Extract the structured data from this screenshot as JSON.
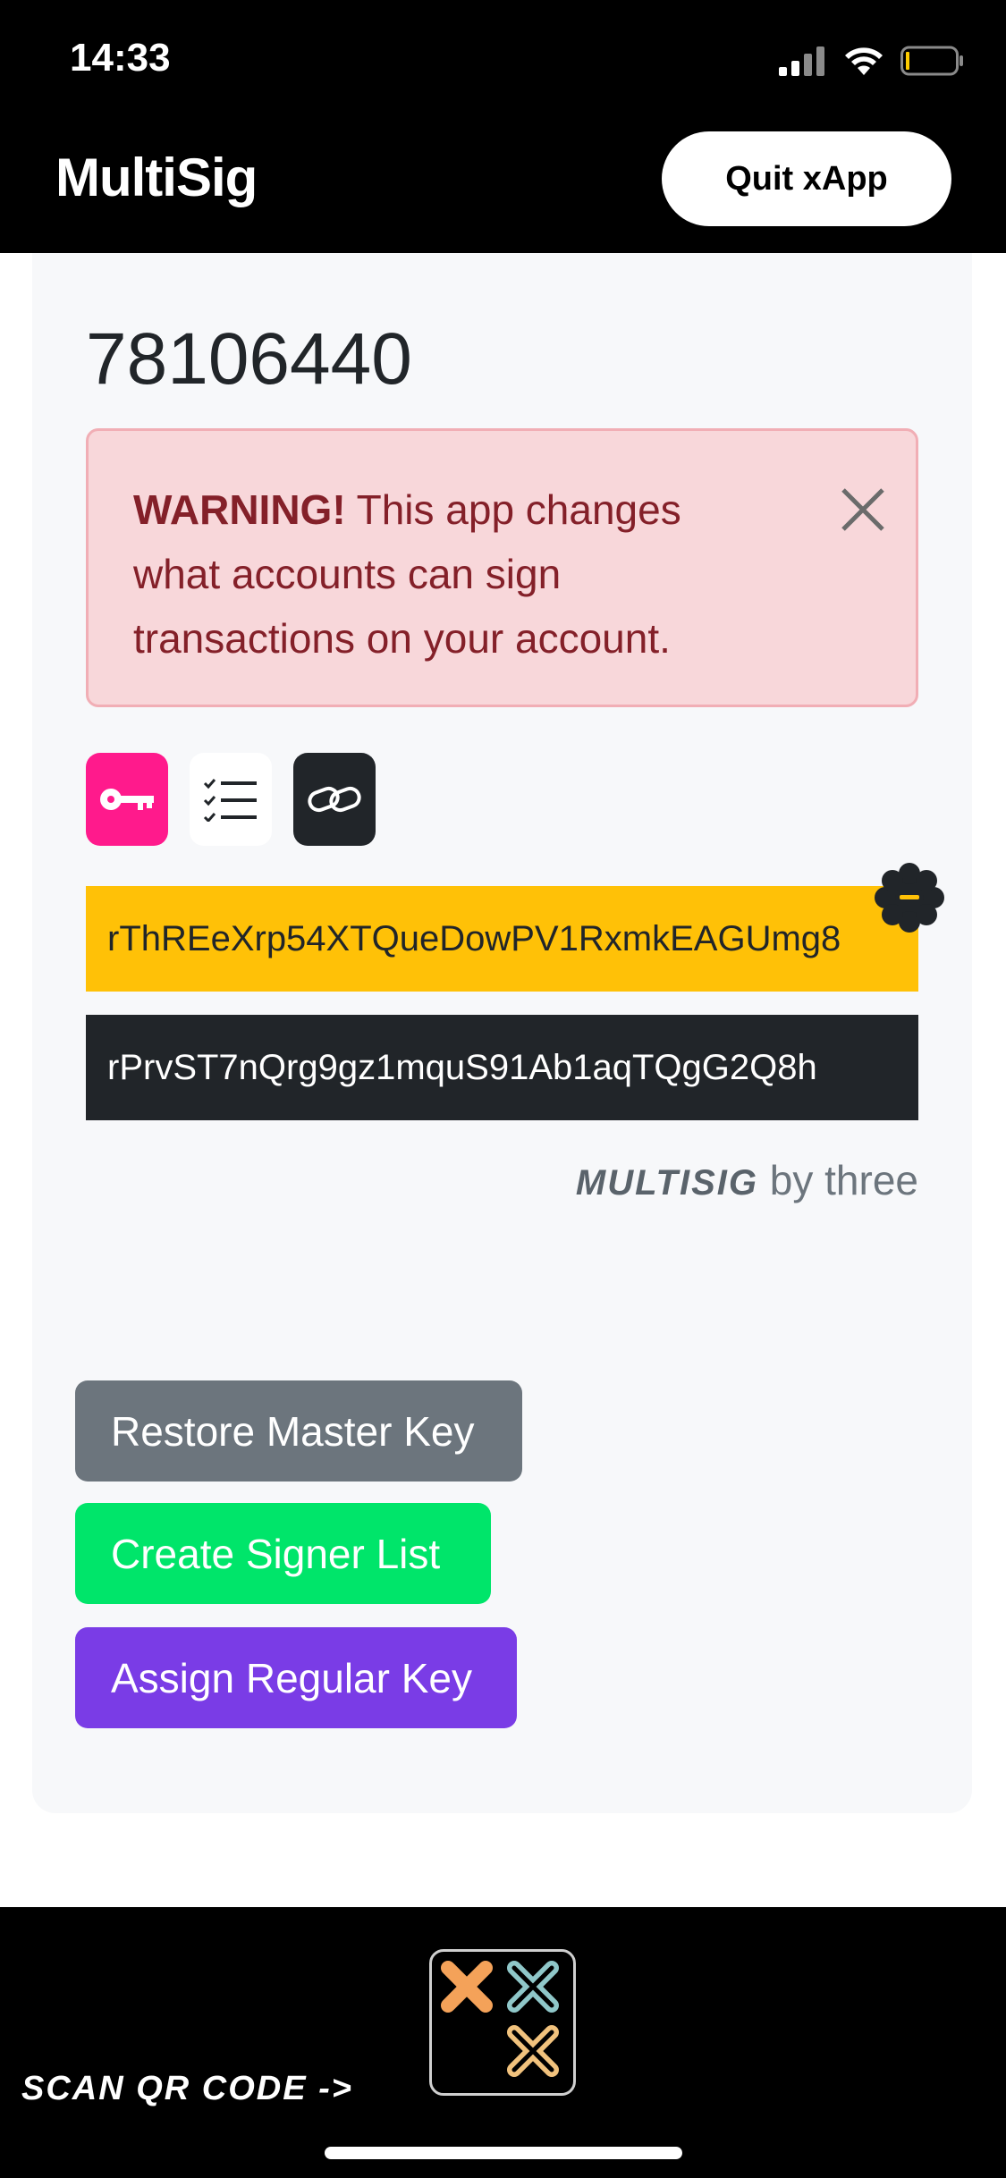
{
  "status_bar": {
    "time": "14:33",
    "icons": [
      "signal-icon",
      "wifi-icon",
      "battery-icon"
    ]
  },
  "header": {
    "title": "MultiSig",
    "quit_label": "Quit xApp"
  },
  "account": {
    "id": "78106440"
  },
  "warning": {
    "bold": "WARNING!",
    "text": " This app changes what accounts can sign transactions on your account."
  },
  "tabs": [
    {
      "icon": "key-icon",
      "color": "#ff1a8c"
    },
    {
      "icon": "list-icon",
      "color": "#ffffff"
    },
    {
      "icon": "link-icon",
      "color": "#212529"
    }
  ],
  "addresses": [
    {
      "value": "rThREeXrp54XTQueDowPV1RxmkEAGUmg8",
      "color": "#ffc107"
    },
    {
      "value": "rPrvST7nQrg9gz1mquS91Ab1aqTQgG2Q8h",
      "color": "#212529"
    }
  ],
  "credit": {
    "brand": "MULTISIG",
    "suffix": " by three"
  },
  "actions": {
    "restore": "Restore Master Key",
    "signer": "Create Signer List",
    "regular": "Assign Regular Key"
  },
  "footer": {
    "scan_label": "SCAN QR CODE ->"
  }
}
